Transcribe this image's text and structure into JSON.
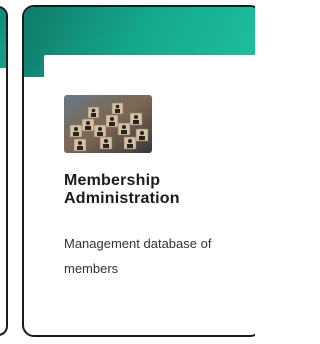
{
  "card": {
    "title": "Membership Administration",
    "description": "Management database of members",
    "image_icon": "members-network-image-icon"
  },
  "colors": {
    "accent_dark": "#0f7a69",
    "accent_light": "#1fc1a3",
    "border": "#1a1a1a",
    "title_text": "#1b1b1b",
    "body_text": "#333333"
  }
}
